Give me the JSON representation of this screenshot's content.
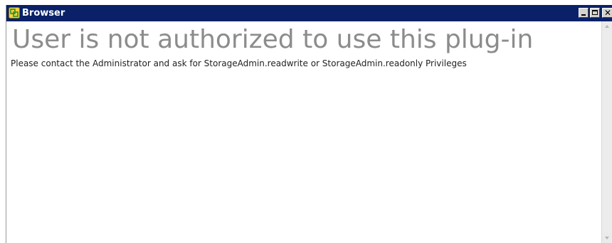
{
  "window": {
    "title": "Browser",
    "icon": "vsphere-app-icon",
    "controls": {
      "minimize_icon": "minimize-icon",
      "maximize_icon": "maximize-icon",
      "close_icon": "close-icon",
      "close_glyph": "✕"
    },
    "colors": {
      "titlebar": "#0a2168",
      "title_text": "#ffffff"
    }
  },
  "content": {
    "heading": "User is not authorized to use this plug-in",
    "message": "Please contact the Administrator and ask for StorageAdmin.readwrite or StorageAdmin.readonly Privileges",
    "colors": {
      "heading": "#8c8c8c",
      "message": "#222222"
    }
  },
  "scrollbar": {
    "up_icon": "scroll-up-arrow-icon",
    "down_icon": "scroll-down-arrow-icon"
  }
}
